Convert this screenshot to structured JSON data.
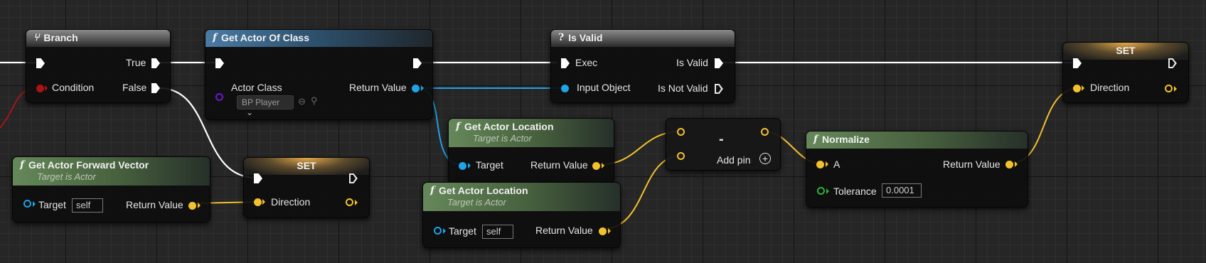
{
  "colors": {
    "exec": "#ffffff",
    "object": "#1fa2e6",
    "vector": "#f2c12e",
    "bool": "#a81414",
    "class": "#6a1bd0",
    "float": "#2bb330"
  },
  "branch": {
    "icon": "branch-icon",
    "title": "Branch",
    "true_label": "True",
    "condition_label": "Condition",
    "false_label": "False"
  },
  "get_actor_of_class": {
    "icon": "function-icon",
    "title": "Get Actor Of Class",
    "actor_class_label": "Actor Class",
    "actor_class_value": "BP Player",
    "return_label": "Return Value"
  },
  "is_valid": {
    "icon": "question-icon",
    "title": "Is Valid",
    "exec_label": "Exec",
    "input_label": "Input Object",
    "valid_label": "Is Valid",
    "not_valid_label": "Is Not Valid"
  },
  "set_right": {
    "title": "SET",
    "direction_label": "Direction"
  },
  "set_left": {
    "title": "SET",
    "direction_label": "Direction"
  },
  "forward_vector": {
    "icon": "function-icon",
    "title": "Get Actor Forward Vector",
    "subtitle": "Target is Actor",
    "target_label": "Target",
    "target_value": "self",
    "return_label": "Return Value"
  },
  "actor_location_1": {
    "icon": "function-icon",
    "title": "Get Actor Location",
    "subtitle": "Target is Actor",
    "target_label": "Target",
    "return_label": "Return Value"
  },
  "actor_location_2": {
    "icon": "function-icon",
    "title": "Get Actor Location",
    "subtitle": "Target is Actor",
    "target_label": "Target",
    "target_value": "self",
    "return_label": "Return Value"
  },
  "subtract": {
    "symbol": "-",
    "add_pin_label": "Add pin",
    "add_icon": "plus-circle-icon"
  },
  "normalize": {
    "icon": "function-icon",
    "title": "Normalize",
    "a_label": "A",
    "tolerance_label": "Tolerance",
    "tolerance_value": "0.0001",
    "return_label": "Return Value"
  }
}
